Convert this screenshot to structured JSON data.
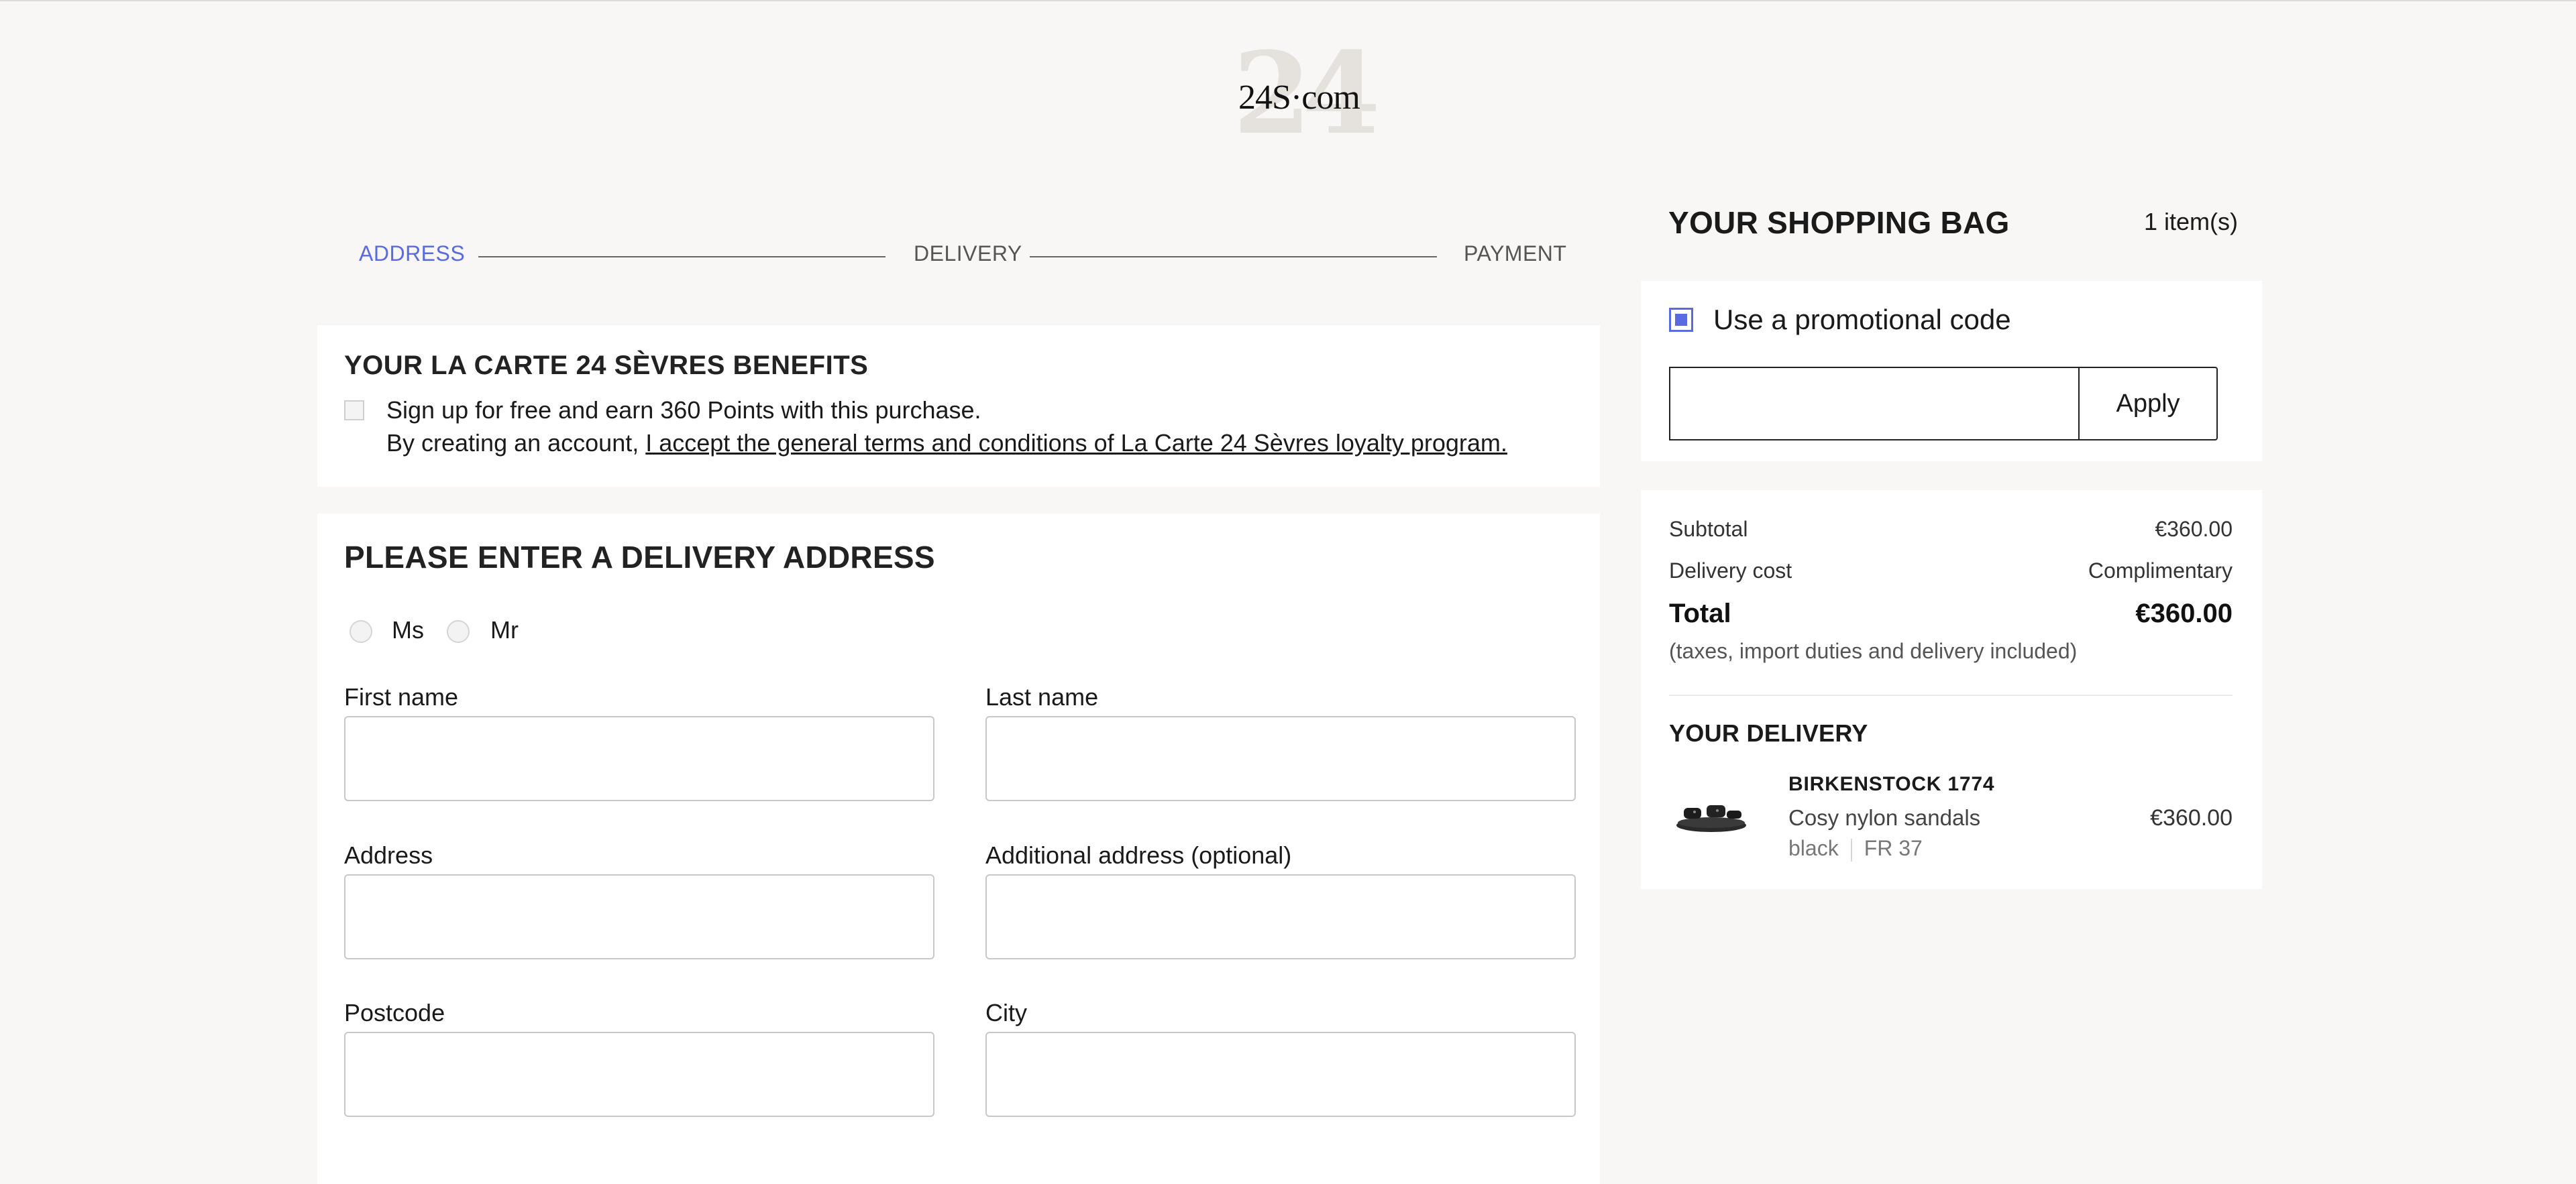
{
  "brand": {
    "logo_text": "24S·com",
    "logo_mark": "24"
  },
  "steps": {
    "address": "ADDRESS",
    "delivery": "DELIVERY",
    "payment": "PAYMENT",
    "active_color": "#5a6ae0"
  },
  "benefits": {
    "title": "YOUR LA CARTE 24 SÈVRES BENEFITS",
    "signup_text": "Sign up for free and earn 360 Points with this purchase.",
    "terms_prefix": "By creating an account, ",
    "terms_link": "I accept the general terms and conditions of La Carte 24 Sèvres loyalty program."
  },
  "address_form": {
    "title": "PLEASE ENTER A DELIVERY ADDRESS",
    "salutations": [
      "Ms",
      "Mr"
    ],
    "labels": {
      "first_name": "First name",
      "last_name": "Last name",
      "address": "Address",
      "additional_address": "Additional address (optional)",
      "postcode": "Postcode",
      "city": "City"
    }
  },
  "bag": {
    "title": "YOUR SHOPPING BAG",
    "count": "1 item(s)",
    "promo_label": "Use a promotional code",
    "promo_value": "",
    "apply_label": "Apply",
    "subtotal_label": "Subtotal",
    "subtotal_value": "€360.00",
    "delivery_label": "Delivery cost",
    "delivery_value": "Complimentary",
    "total_label": "Total",
    "total_value": "€360.00",
    "tax_note": "(taxes, import duties and delivery included)",
    "delivery_title": "YOUR DELIVERY",
    "item": {
      "brand": "BIRKENSTOCK 1774",
      "name": "Cosy nylon sandals",
      "color": "black",
      "size": "FR 37",
      "price": "€360.00"
    }
  }
}
